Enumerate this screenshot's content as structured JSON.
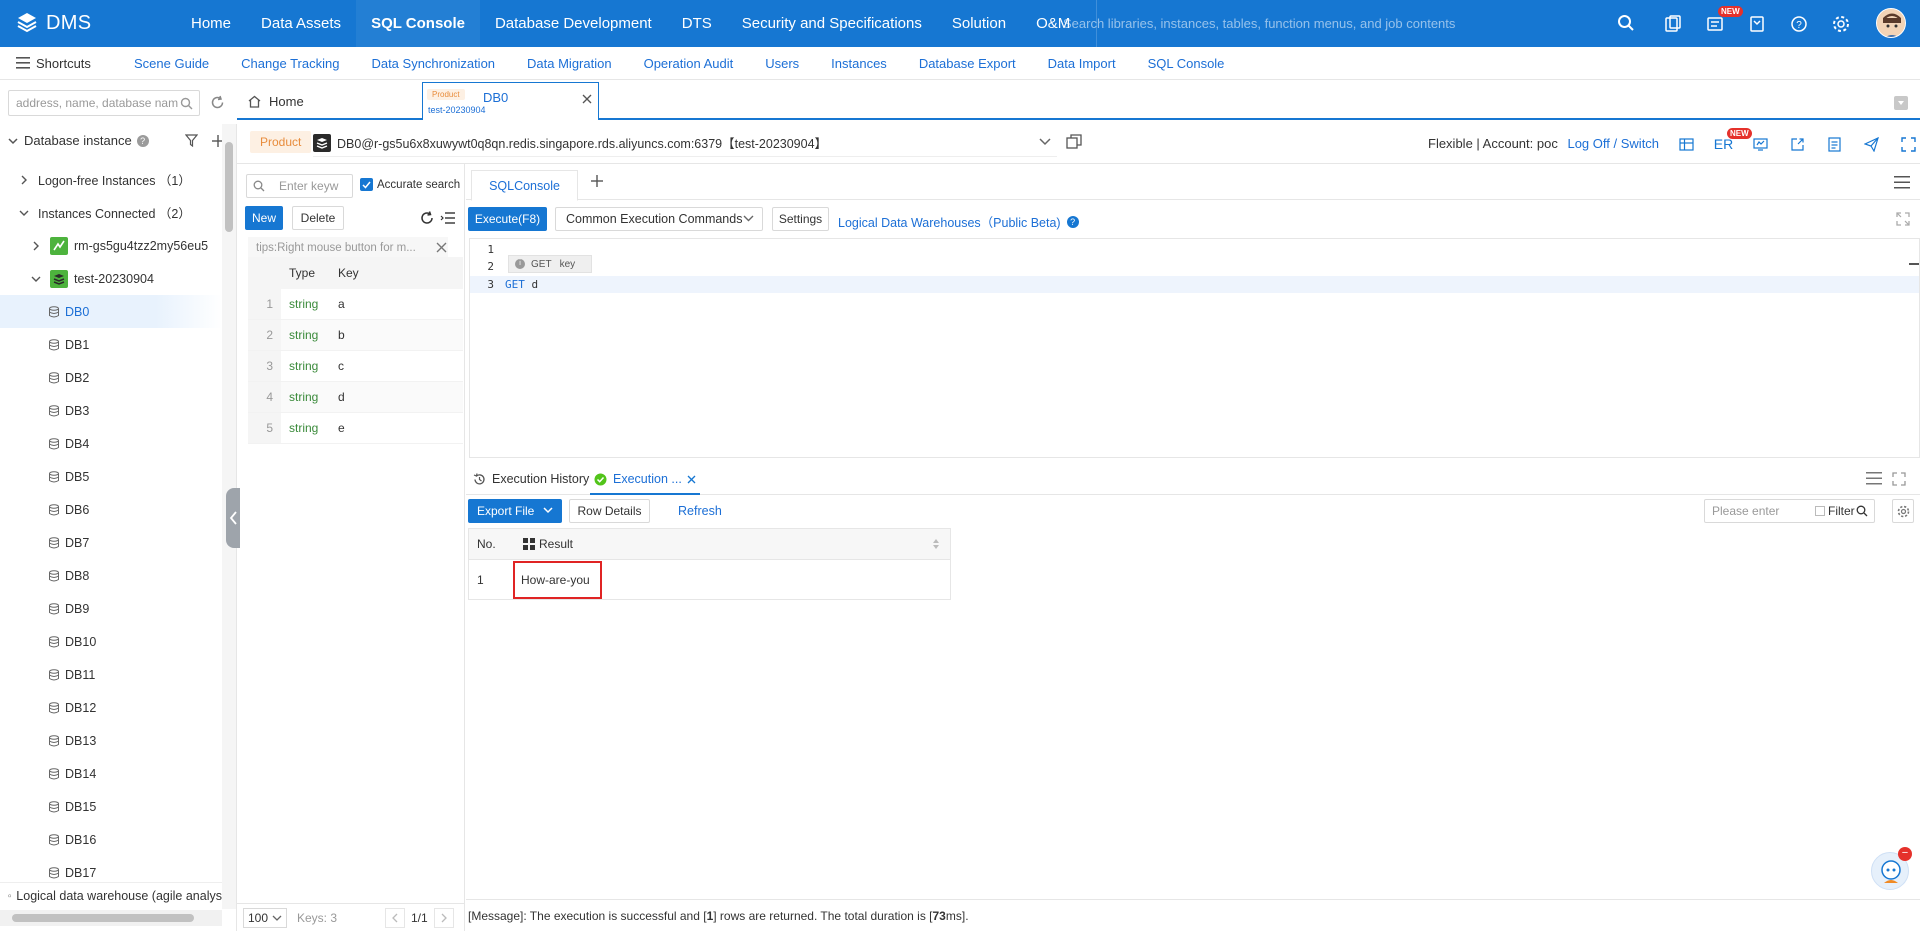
{
  "topnav": {
    "logo_text": "DMS",
    "items": [
      {
        "label": "Home"
      },
      {
        "label": "Data Assets"
      },
      {
        "label": "SQL Console"
      },
      {
        "label": "Database Development"
      },
      {
        "label": "DTS"
      },
      {
        "label": "Security and Specifications"
      },
      {
        "label": "Solution"
      },
      {
        "label": "O&M"
      }
    ],
    "search_placeholder": "Search libraries, instances, tables, function menus, and job contents",
    "new_badge": "NEW"
  },
  "shortcuts": {
    "label": "Shortcuts",
    "links": [
      "Scene Guide",
      "Change Tracking",
      "Data Synchronization",
      "Data Migration",
      "Operation Audit",
      "Users",
      "Instances",
      "Database Export",
      "Data Import",
      "SQL Console"
    ]
  },
  "left": {
    "address_placeholder": "address, name, database nam",
    "db_instance_label": "Database instance",
    "help_glyph": "?",
    "logon_free": "Logon-free Instances （1）",
    "connected": "Instances Connected （2）",
    "inst1": "rm-gs5gu4tzz2my56eu5",
    "inst2": "test-20230904",
    "databases": [
      "DB0",
      "DB1",
      "DB2",
      "DB3",
      "DB4",
      "DB5",
      "DB6",
      "DB7",
      "DB8",
      "DB9",
      "DB10",
      "DB11",
      "DB12",
      "DB13",
      "DB14",
      "DB15",
      "DB16",
      "DB17"
    ],
    "logical_dw": "Logical data warehouse (agile analys"
  },
  "tabs": {
    "home": "Home",
    "active_tag": "Product",
    "active_title": "DB0",
    "active_sub": "test-20230904"
  },
  "connection": {
    "tag": "Product",
    "label": "DB0@r-gs5u6x8xuwywt0q8qn.redis.singapore.rds.aliyuncs.com:6379【test-20230904】",
    "mode": "Flexible | Account: poc",
    "log_off": "Log Off",
    "slash": "/",
    "switch": "Switch",
    "er": "ER",
    "new_badge": "NEW"
  },
  "keys": {
    "search_placeholder": "Enter keyw",
    "accurate": "Accurate search",
    "new_btn": "New",
    "delete_btn": "Delete",
    "tips": "tips:Right mouse button for m...",
    "col_type": "Type",
    "col_key": "Key",
    "rows": [
      {
        "no": "1",
        "type": "string",
        "key": "a"
      },
      {
        "no": "2",
        "type": "string",
        "key": "b"
      },
      {
        "no": "3",
        "type": "string",
        "key": "c"
      },
      {
        "no": "4",
        "type": "string",
        "key": "d"
      },
      {
        "no": "5",
        "type": "string",
        "key": "e"
      }
    ],
    "page_size": "100",
    "count": "Keys: 3",
    "page": "1/1"
  },
  "console": {
    "tab": "SQLConsole",
    "execute": "Execute(F8)",
    "common_cmds": "Common Execution Commands",
    "settings": "Settings",
    "ldw_link": "Logical Data Warehouses（Public Beta)",
    "help_glyph": "?",
    "lines": [
      "1",
      "2",
      "3"
    ],
    "hint_cmd": "GET",
    "hint_arg": "key",
    "code_kw": "GET",
    "code_arg": "d"
  },
  "results": {
    "history": "Execution History",
    "exec_tab": "Execution ...",
    "export": "Export File",
    "row_details": "Row Details",
    "refresh": "Refresh",
    "search_placeholder": "Please enter",
    "filter": "Filter",
    "col_no": "No.",
    "col_result": "Result",
    "rows": [
      {
        "no": "1",
        "result": "How-are-you"
      }
    ]
  },
  "status": {
    "prefix": "[Message]: The execution is successful and [",
    "rows": "1",
    "mid": "] rows are returned. The total duration is [",
    "ms": "73",
    "suffix": "ms]."
  }
}
